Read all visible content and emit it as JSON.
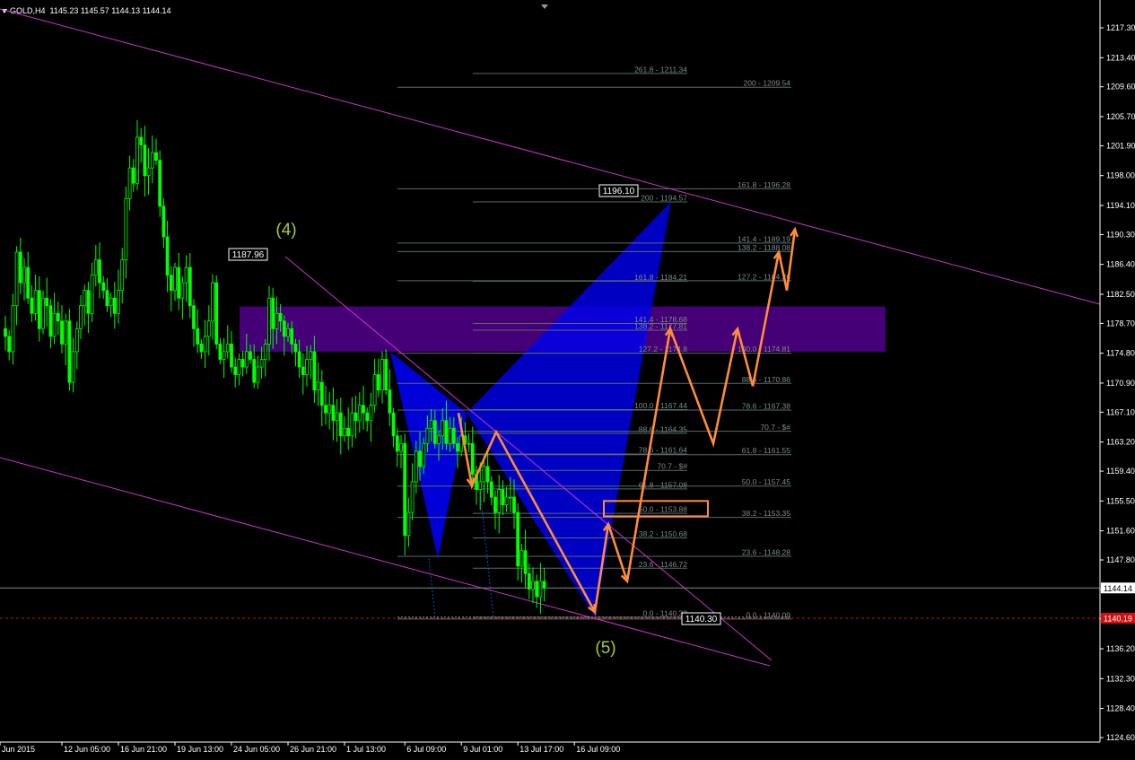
{
  "header": {
    "symbol": "GOLD,H4",
    "ohlc": "1145.23 1145.57 1144.13 1144.14"
  },
  "chart_data": {
    "type": "candlestick",
    "symbol": "GOLD",
    "timeframe": "H4",
    "y_range": [
      1124.0,
      1220.0
    ],
    "y_ticks": [
      "1217.30",
      "1213.40",
      "1209.60",
      "1205.70",
      "1201.90",
      "1198.00",
      "1194.10",
      "1190.30",
      "1186.40",
      "1182.50",
      "1178.70",
      "1174.80",
      "1170.90",
      "1167.10",
      "1163.20",
      "1159.40",
      "1155.50",
      "1151.60",
      "1147.80",
      "1143.90",
      "1140.10",
      "1136.20",
      "1132.30",
      "1128.40",
      "1124.60"
    ],
    "x_ticks": [
      {
        "label": "Jun 2015",
        "bar": 0
      },
      {
        "label": "12 Jun 05:00",
        "bar": 15
      },
      {
        "label": "16 Jun 21:00",
        "bar": 30
      },
      {
        "label": "19 Jun 13:00",
        "bar": 45
      },
      {
        "label": "24 Jun 05:00",
        "bar": 60
      },
      {
        "label": "26 Jun 21:00",
        "bar": 75
      },
      {
        "label": "1 Jul 13:00",
        "bar": 90
      },
      {
        "label": "6 Jul 09:00",
        "bar": 106
      },
      {
        "label": "9 Jul 01:00",
        "bar": 121
      },
      {
        "label": "13 Jul 17:00",
        "bar": 136
      },
      {
        "label": "16 Jul 09:00",
        "bar": 151
      }
    ],
    "closes": [
      1177,
      1175,
      1181,
      1188,
      1184,
      1186,
      1182,
      1180,
      1183,
      1178,
      1182,
      1181,
      1177,
      1180,
      1179,
      1176,
      1179,
      1171,
      1175,
      1178,
      1181,
      1183,
      1180,
      1185,
      1187,
      1184,
      1183,
      1181,
      1182,
      1180,
      1183,
      1187,
      1195,
      1199,
      1197,
      1203,
      1202,
      1198,
      1199,
      1201,
      1200,
      1194,
      1190,
      1185,
      1183,
      1186,
      1182,
      1184,
      1186,
      1181,
      1178,
      1176,
      1175,
      1177,
      1179,
      1184,
      1176,
      1174,
      1175,
      1176,
      1173,
      1172,
      1174,
      1173,
      1175,
      1174,
      1171,
      1173,
      1174,
      1176,
      1182,
      1178,
      1180,
      1179,
      1177,
      1178,
      1176,
      1175,
      1173,
      1172,
      1174,
      1175,
      1170,
      1171,
      1168,
      1167,
      1168,
      1166,
      1167,
      1164,
      1165,
      1164,
      1167,
      1166,
      1168,
      1167,
      1166,
      1168,
      1172,
      1170,
      1174,
      1170,
      1167,
      1164,
      1162,
      1163,
      1151,
      1154,
      1158,
      1162,
      1160,
      1163,
      1165,
      1166,
      1163,
      1164,
      1166,
      1163,
      1165,
      1163,
      1162,
      1164,
      1163,
      1163,
      1159,
      1157,
      1158,
      1160,
      1158,
      1156,
      1154,
      1157,
      1155,
      1156,
      1156,
      1154,
      1147,
      1149,
      1146,
      1144,
      1145,
      1143,
      1145,
      1144.14
    ],
    "series_candles": {
      "name": "GOLD,H4",
      "up_color": "#00ff00",
      "down_color": "#00ff00"
    },
    "current_price": "1144.14",
    "red_line_price": "1140.19",
    "boxed_labels": [
      {
        "text": "1187.96",
        "price": 1187.96
      },
      {
        "text": "1196.10",
        "price": 1196.1
      },
      {
        "text": "1140.30",
        "price": 1140.3
      }
    ],
    "wave_labels": [
      "(4)",
      "(5)"
    ],
    "fib_set_a": [
      {
        "text": "261.8 - 1211.34",
        "price": 1211.34
      },
      {
        "text": "200 - 1194.57",
        "price": 1194.57
      },
      {
        "text": "161.8 - 1184.21",
        "price": 1184.21
      },
      {
        "text": "141.4 - 1178.68",
        "price": 1178.68
      },
      {
        "text": "138.2 - 1177.81",
        "price": 1177.81
      },
      {
        "text": "127.2 - 1174.8",
        "price": 1174.8
      },
      {
        "text": "100.0 - 1167.44",
        "price": 1167.44
      },
      {
        "text": "88.6 - 1164.35",
        "price": 1164.35
      },
      {
        "text": "78.6 - 1161.64",
        "price": 1161.64
      },
      {
        "text": "70.7 - $#",
        "price": 1159.5
      },
      {
        "text": "61.8 - 1157.08",
        "price": 1157.08
      },
      {
        "text": "50.0 - 1153.88",
        "price": 1153.88
      },
      {
        "text": "38.2 - 1150.68",
        "price": 1150.68
      },
      {
        "text": "23.6 - 1146.72",
        "price": 1146.72
      },
      {
        "text": "0.0 - 1140.32",
        "price": 1140.32
      }
    ],
    "fib_set_b": [
      {
        "text": "200 - 1209.54",
        "price": 1209.54
      },
      {
        "text": "161.8 - 1196.28",
        "price": 1196.28
      },
      {
        "text": "141.4 - 1189.19",
        "price": 1189.19
      },
      {
        "text": "138.2 - 1188.08",
        "price": 1188.08
      },
      {
        "text": "127.2 - 1184.26",
        "price": 1184.26
      },
      {
        "text": "100.0 - 1174.81",
        "price": 1174.81
      },
      {
        "text": "88.6 - 1170.86",
        "price": 1170.86
      },
      {
        "text": "78.6 - 1167.38",
        "price": 1167.38
      },
      {
        "text": "70.7 - $#",
        "price": 1164.6
      },
      {
        "text": "61.8 - 1161.55",
        "price": 1161.55
      },
      {
        "text": "50.0 - 1157.45",
        "price": 1157.45
      },
      {
        "text": "38.2 - 1153.35",
        "price": 1153.35
      },
      {
        "text": "23.6 - 1148.28",
        "price": 1148.28
      },
      {
        "text": "0.0 - 1140.09",
        "price": 1140.09
      }
    ],
    "projection_path_prices": [
      1167.0,
      1157.5,
      1164.5,
      1141.0,
      1152.5,
      1145.0,
      1178.0,
      1163.0,
      1178.0,
      1170.5,
      1188.0,
      1183.0,
      1191.0
    ],
    "zone": {
      "top": 1180.9,
      "bottom": 1175.0,
      "color": "#4b0082"
    },
    "orange_box": {
      "top": 1155.5,
      "bottom": 1153.5,
      "color": "#ff8c3a"
    },
    "colors": {
      "background": "#000000",
      "axis": "#ffffff",
      "trendline": "#cc33cc",
      "fib": "#5a6a6a",
      "pattern": "#0000ee",
      "projection": "#ff8c3a",
      "wave_label": "#a8c83c",
      "red_line": "#d01010"
    }
  }
}
